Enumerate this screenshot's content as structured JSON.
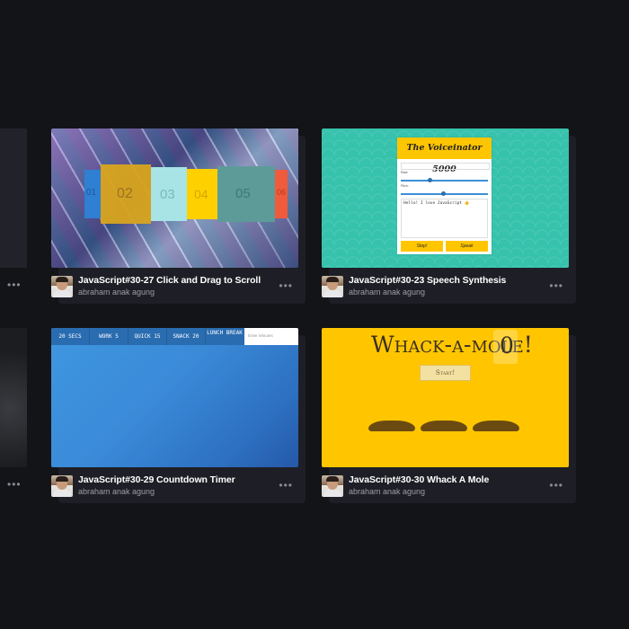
{
  "pens": [
    {
      "title": "JavaScript#30-27 Click and Drag to Scroll",
      "author": "abraham anak agung",
      "more_label": "•••",
      "preview": {
        "items": [
          "01",
          "02",
          "03",
          "04",
          "05",
          "06"
        ]
      }
    },
    {
      "title": "JavaScript#30-23 Speech Synthesis",
      "author": "abraham anak agung",
      "more_label": "•••",
      "preview": {
        "app_title": "The Voiceinator 5000",
        "rate_label": "Rate:",
        "pitch_label": "Pitch:",
        "message": "Hello! I love JavaScript 👍",
        "stop_label": "Stop!",
        "speak_label": "Speak"
      }
    },
    {
      "title": "JavaScript#30-29 Countdown Timer",
      "author": "abraham anak agung",
      "more_label": "•••",
      "preview": {
        "buttons": [
          "20 SECS",
          "WORK 5",
          "QUICK 15",
          "SNACK 20",
          "LUNCH BREAK"
        ],
        "input_placeholder": "Enter Minutes"
      }
    },
    {
      "title": "JavaScript#30-30 Whack A Mole",
      "author": "abraham anak agung",
      "more_label": "•••",
      "preview": {
        "heading": "Whack-a-mole!",
        "score": "0",
        "start_label": "Start!"
      }
    }
  ],
  "colors": {
    "background": "#131417",
    "card": "#1e1f26",
    "speech_bg": "#36c2ac",
    "speech_accent": "#ffc600",
    "countdown_bar": "#2a6cb0",
    "mole_bg": "#ffc600"
  },
  "icons": [
    "more-icon",
    "avatar"
  ]
}
